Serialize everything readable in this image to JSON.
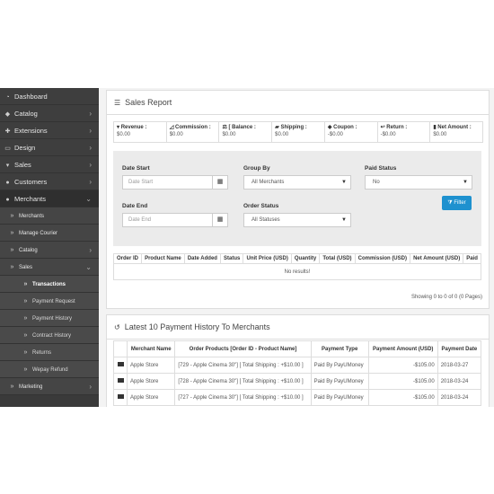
{
  "sidebar": {
    "items": [
      {
        "label": "Dashboard",
        "icon": "dashboard-icon",
        "glyph": "◔",
        "level": 0,
        "arrow": ""
      },
      {
        "label": "Catalog",
        "icon": "tag-icon",
        "glyph": "◆",
        "level": 0,
        "arrow": "›"
      },
      {
        "label": "Extensions",
        "icon": "puzzle-icon",
        "glyph": "✚",
        "level": 0,
        "arrow": "›"
      },
      {
        "label": "Design",
        "icon": "monitor-icon",
        "glyph": "▭",
        "level": 0,
        "arrow": "›"
      },
      {
        "label": "Sales",
        "icon": "cart-icon",
        "glyph": "▾",
        "level": 0,
        "arrow": "›"
      },
      {
        "label": "Customers",
        "icon": "user-icon",
        "glyph": "●",
        "level": 0,
        "arrow": "›"
      },
      {
        "label": "Merchants",
        "icon": "users-icon",
        "glyph": "●",
        "level": 0,
        "arrow": "⌄"
      },
      {
        "label": "Merchants",
        "icon": "chevron-double-right-icon",
        "glyph": "»",
        "level": 1,
        "arrow": ""
      },
      {
        "label": "Manage Courier",
        "icon": "chevron-double-right-icon",
        "glyph": "»",
        "level": 1,
        "arrow": ""
      },
      {
        "label": "Catalog",
        "icon": "chevron-double-right-icon",
        "glyph": "»",
        "level": 1,
        "arrow": "›"
      },
      {
        "label": "Sales",
        "icon": "chevron-double-right-icon",
        "glyph": "»",
        "level": 1,
        "arrow": "⌄"
      },
      {
        "label": "Transactions",
        "icon": "chevron-double-right-icon",
        "glyph": "»",
        "level": 2,
        "arrow": "",
        "current": true
      },
      {
        "label": "Payment Request",
        "icon": "chevron-double-right-icon",
        "glyph": "»",
        "level": 2,
        "arrow": ""
      },
      {
        "label": "Payment History",
        "icon": "chevron-double-right-icon",
        "glyph": "»",
        "level": 2,
        "arrow": ""
      },
      {
        "label": "Contract History",
        "icon": "chevron-double-right-icon",
        "glyph": "»",
        "level": 2,
        "arrow": ""
      },
      {
        "label": "Returns",
        "icon": "chevron-double-right-icon",
        "glyph": "»",
        "level": 2,
        "arrow": ""
      },
      {
        "label": "Wepay Refund",
        "icon": "chevron-double-right-icon",
        "glyph": "»",
        "level": 2,
        "arrow": ""
      },
      {
        "label": "Marketing",
        "icon": "chevron-double-right-icon",
        "glyph": "»",
        "level": 1,
        "arrow": "›"
      }
    ]
  },
  "sales_report": {
    "title": "Sales Report",
    "stats": [
      {
        "label": "Revenue :",
        "value": "$0.00",
        "icon": "cart-icon"
      },
      {
        "label": "Commission :",
        "value": "$0.00",
        "icon": "chart-icon"
      },
      {
        "label": "[ Balance :",
        "value": "$0.00",
        "icon": "balance-icon"
      },
      {
        "label": "Shipping :",
        "value": "$0.00",
        "icon": "truck-icon"
      },
      {
        "label": "Coupon :",
        "value": "-$0.00",
        "icon": "tag-icon"
      },
      {
        "label": "Return :",
        "value": "-$0.00",
        "icon": "return-icon"
      },
      {
        "label": "Net Amount :",
        "value": "$0.00",
        "icon": "file-icon"
      }
    ],
    "filter": {
      "date_start_label": "Date Start",
      "date_start_placeholder": "Date Start",
      "date_end_label": "Date End",
      "date_end_placeholder": "Date End",
      "group_by_label": "Group By",
      "group_by_value": "All Merchants",
      "order_status_label": "Order Status",
      "order_status_value": "All Statuses",
      "paid_status_label": "Paid Status",
      "paid_status_value": "No",
      "filter_button": "Filter"
    },
    "table": {
      "columns": [
        "Order ID",
        "Product Name",
        "Date Added",
        "Status",
        "Unit Price (USD)",
        "Quantity",
        "Total (USD)",
        "Commission (USD)",
        "Net Amount (USD)",
        "Paid"
      ],
      "empty_text": "No results!"
    },
    "pagination": "Showing 0 to 0 of 0 (0 Pages)"
  },
  "payment_history": {
    "title": "Latest 10 Payment History To Merchants",
    "columns": [
      "Merchant Name",
      "Order Products [Order ID - Product Name]",
      "Payment Type",
      "Payment Amount (USD)",
      "Payment Date"
    ],
    "rows": [
      {
        "merchant": "Apple Store",
        "products": "[729 - Apple Cinema 30\"] [ Total Shipping : +$10.00 ]",
        "type": "Paid By PayUMoney",
        "amount": "-$105.00",
        "date": "2018-03-27"
      },
      {
        "merchant": "Apple Store",
        "products": "[728 - Apple Cinema 30\"] [ Total Shipping : +$10.00 ]",
        "type": "Paid By PayUMoney",
        "amount": "-$105.00",
        "date": "2018-03-24"
      },
      {
        "merchant": "Apple Store",
        "products": "[727 - Apple Cinema 30\"] [ Total Shipping : +$10.00 ]",
        "type": "Paid By PayUMoney",
        "amount": "-$105.00",
        "date": "2018-03-24"
      }
    ]
  }
}
